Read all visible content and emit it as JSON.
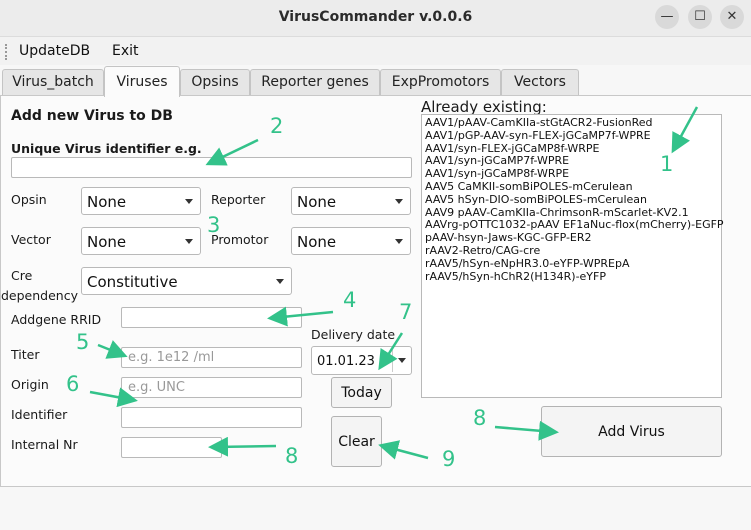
{
  "window": {
    "title": "VirusCommander v.0.0.6",
    "minimize_glyph": "—",
    "maximize_glyph": "☐",
    "close_glyph": "✕"
  },
  "menu": {
    "items": [
      "UpdateDB",
      "Exit"
    ]
  },
  "tabs": [
    {
      "label": "Virus_batch",
      "active": false
    },
    {
      "label": "Viruses",
      "active": true
    },
    {
      "label": "Opsins",
      "active": false
    },
    {
      "label": "Reporter genes",
      "active": false
    },
    {
      "label": "ExpPromotors",
      "active": false
    },
    {
      "label": "Vectors",
      "active": false
    }
  ],
  "form": {
    "heading": "Add new Virus to DB",
    "unique_id_label": "Unique Virus identifier e.g.",
    "unique_id_value": "",
    "opsin_label": "Opsin",
    "opsin_value": "None",
    "reporter_label": "Reporter",
    "reporter_value": "None",
    "vector_label": "Vector",
    "vector_value": "None",
    "promotor_label": "Promotor",
    "promotor_value": "None",
    "cre_label_line1": "Cre",
    "cre_label_line2": "dependency",
    "cre_value": "Constitutive",
    "addgene_label": "Addgene RRID",
    "addgene_value": "",
    "titer_label": "Titer",
    "titer_placeholder": "e.g. 1e12 /ml",
    "origin_label": "Origin",
    "origin_placeholder": "e.g. UNC",
    "identifier_label": "Identifier",
    "identifier_value": "",
    "internal_label": "Internal Nr",
    "internal_value": "",
    "delivery_label": "Delivery date",
    "delivery_value": "01.01.23",
    "today_button": "Today",
    "clear_button": "Clear",
    "add_button": "Add Virus"
  },
  "existing": {
    "label": "Already existing:",
    "items": [
      "AAV1/pAAV-CamKIIa-stGtACR2-FusionRed",
      "AAV1/pGP-AAV-syn-FLEX-jGCaMP7f-WPRE",
      "AAV1/syn-FLEX-jGCaMP8f-WRPE",
      "AAV1/syn-jGCaMP7f-WPRE",
      "AAV1/syn-jGCaMP8f-WRPE",
      "AAV5 CaMKII-somBiPOLES-mCerulean",
      "AAV5 hSyn-DIO-somBiPOLES-mCerulean",
      "AAV9 pAAV-CamKIIa-ChrimsonR-mScarlet-KV2.1",
      "AAVrg-pOTTC1032-pAAV EF1aNuc-flox(mCherry)-EGFP",
      "pAAV-hsyn-Jaws-KGC-GFP-ER2",
      "rAAV2-Retro/CAG-cre",
      "rAAV5/hSyn-eNpHR3.0-eYFP-WPREpA",
      "rAAV5/hSyn-hChR2(H134R)-eYFP"
    ]
  },
  "annotations": {
    "numbers": [
      "1",
      "2",
      "3",
      "4",
      "5",
      "6",
      "7",
      "8",
      "8",
      "9"
    ],
    "color": "#33c28a"
  }
}
